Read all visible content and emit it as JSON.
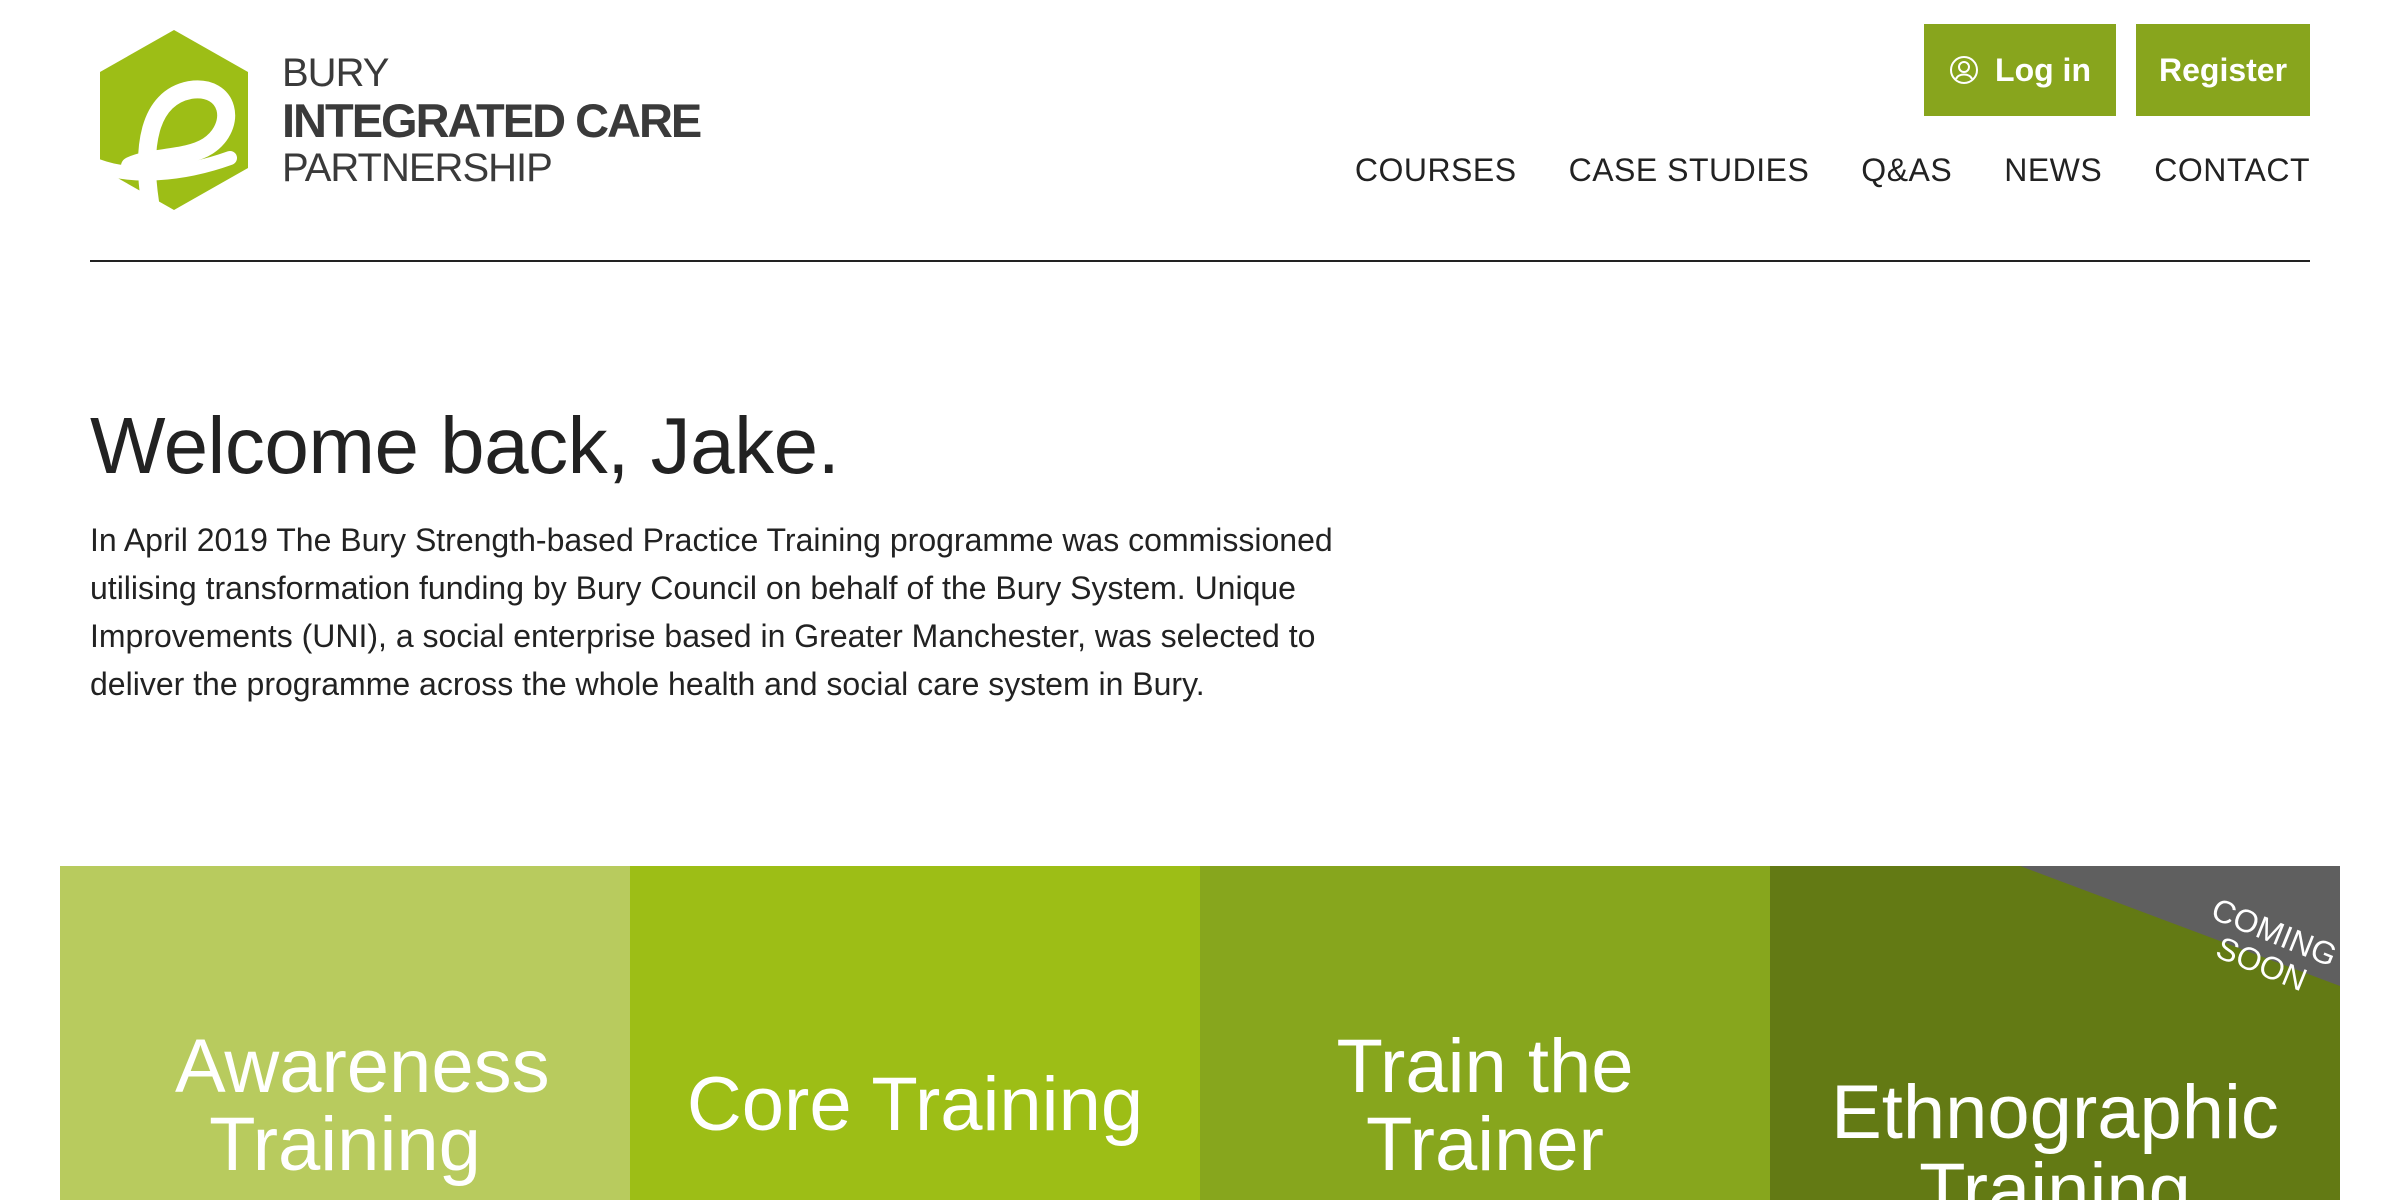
{
  "brand": {
    "line1": "BURY",
    "line2": "INTEGRATED CARE",
    "line3": "PARTNERSHIP",
    "accent": "#9dbe16",
    "logo_icon": "partnership-ribbon-icon"
  },
  "header": {
    "login_label": "Log in",
    "login_icon": "user-circle-icon",
    "register_label": "Register",
    "nav": [
      {
        "label": "COURSES"
      },
      {
        "label": "CASE STUDIES"
      },
      {
        "label": "Q&AS"
      },
      {
        "label": "NEWS"
      },
      {
        "label": "CONTACT"
      }
    ]
  },
  "intro": {
    "welcome": "Welcome back, Jake.",
    "body": "In April 2019 The Bury Strength-based Practice Training programme was commissioned utilising transformation funding by Bury Council on behalf of the Bury System. Unique Improvements (UNI), a social enterprise based in Greater Manchester, was selected to deliver the programme across the whole health and social care system in Bury."
  },
  "tiles": [
    {
      "label": "Awareness Training",
      "color": "#b8cb5e"
    },
    {
      "label": "Core Training",
      "color": "#9dbe16"
    },
    {
      "label": "Train the Trainer",
      "color": "#87a61d"
    },
    {
      "label": "Ethnographic Training",
      "color": "#637a14",
      "badge": "COMING SOON",
      "badge_color": "#5f5f5f"
    }
  ]
}
